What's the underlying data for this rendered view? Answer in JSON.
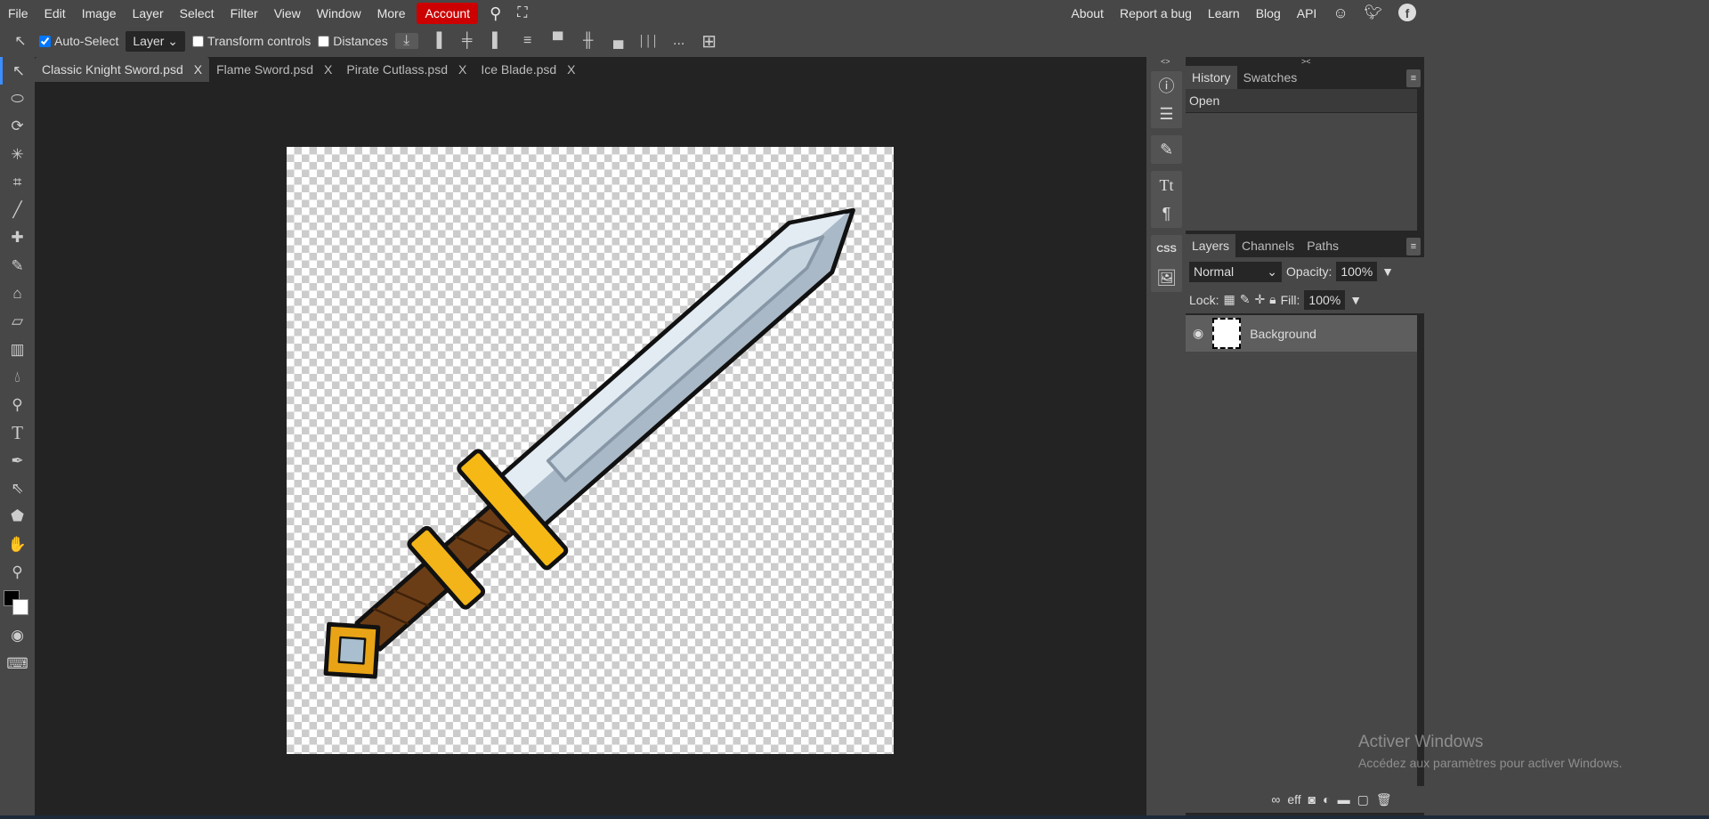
{
  "menu": {
    "items": [
      "File",
      "Edit",
      "Image",
      "Layer",
      "Select",
      "Filter",
      "View",
      "Window",
      "More"
    ],
    "account": "Account",
    "right": [
      "About",
      "Report a bug",
      "Learn",
      "Blog",
      "API"
    ]
  },
  "options": {
    "auto_select": "Auto-Select",
    "auto_select_checked": true,
    "layer_select": "Layer",
    "transform_controls": "Transform controls",
    "distances": "Distances",
    "more": "..."
  },
  "tabs": [
    {
      "label": "Classic Knight Sword.psd",
      "active": true
    },
    {
      "label": "Flame Sword.psd"
    },
    {
      "label": "Pirate Cutlass.psd"
    },
    {
      "label": "Ice Blade.psd"
    }
  ],
  "tab_close": "X",
  "history": {
    "tabs": [
      "History",
      "Swatches"
    ],
    "items": [
      "Open"
    ]
  },
  "layers": {
    "tabs": [
      "Layers",
      "Channels",
      "Paths"
    ],
    "blend_mode": "Normal",
    "opacity_label": "Opacity:",
    "opacity": "100%",
    "lock_label": "Lock:",
    "fill_label": "Fill:",
    "fill": "100%",
    "items": [
      {
        "name": "Background",
        "visible": true
      }
    ],
    "bottom_eff": "eff"
  },
  "icons": {
    "css": "CSS"
  },
  "watermark": {
    "title": "Activer Windows",
    "subtitle": "Accédez aux paramètres pour activer Windows."
  },
  "colors": {
    "accent": "#cc0000",
    "active_tool": "#3d8eff",
    "foreground": "#000000",
    "background": "#ffffff"
  }
}
